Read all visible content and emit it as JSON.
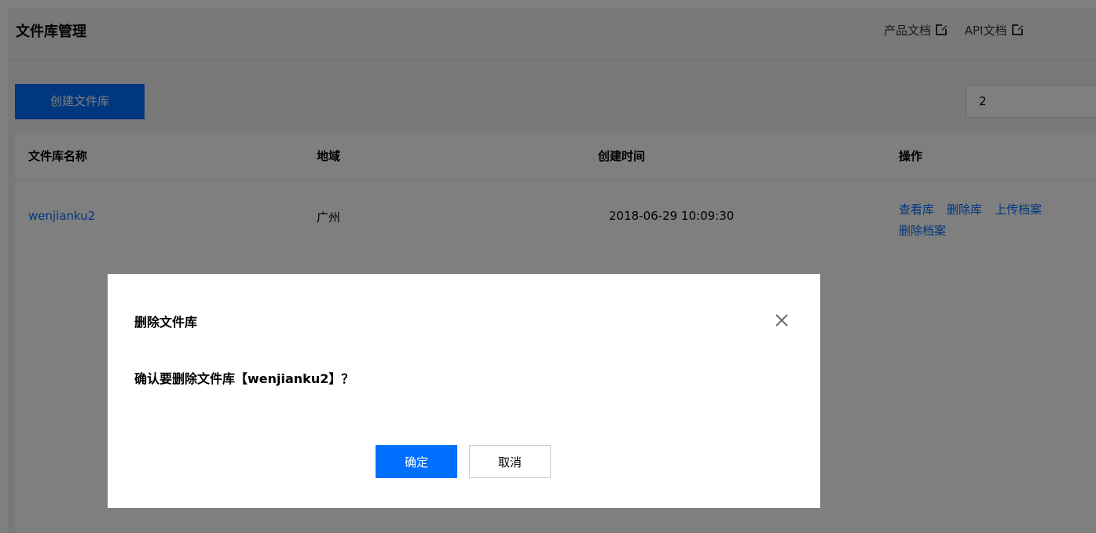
{
  "header": {
    "title": "文件库管理",
    "links": [
      "产品文档",
      "API文档"
    ]
  },
  "toolbar": {
    "create_label": "创建文件库",
    "page_value": "2"
  },
  "table": {
    "columns": [
      "文件库名称",
      "地域",
      "创建时间",
      "操作"
    ],
    "rows": [
      {
        "name": "wenjianku2",
        "region": "广州",
        "created": "2018-06-29 10:09:30",
        "actions": [
          "查看库",
          "删除库",
          "上传档案",
          "删除档案"
        ]
      }
    ]
  },
  "dialog": {
    "title": "删除文件库",
    "message": "确认要删除文件库【wenjianku2】？",
    "confirm_label": "确定",
    "cancel_label": "取消"
  },
  "colors": {
    "accent": "#006eff",
    "overlay": "rgba(0,0,0,0.5)"
  },
  "icons": [
    "external-link-icon",
    "close-icon"
  ]
}
